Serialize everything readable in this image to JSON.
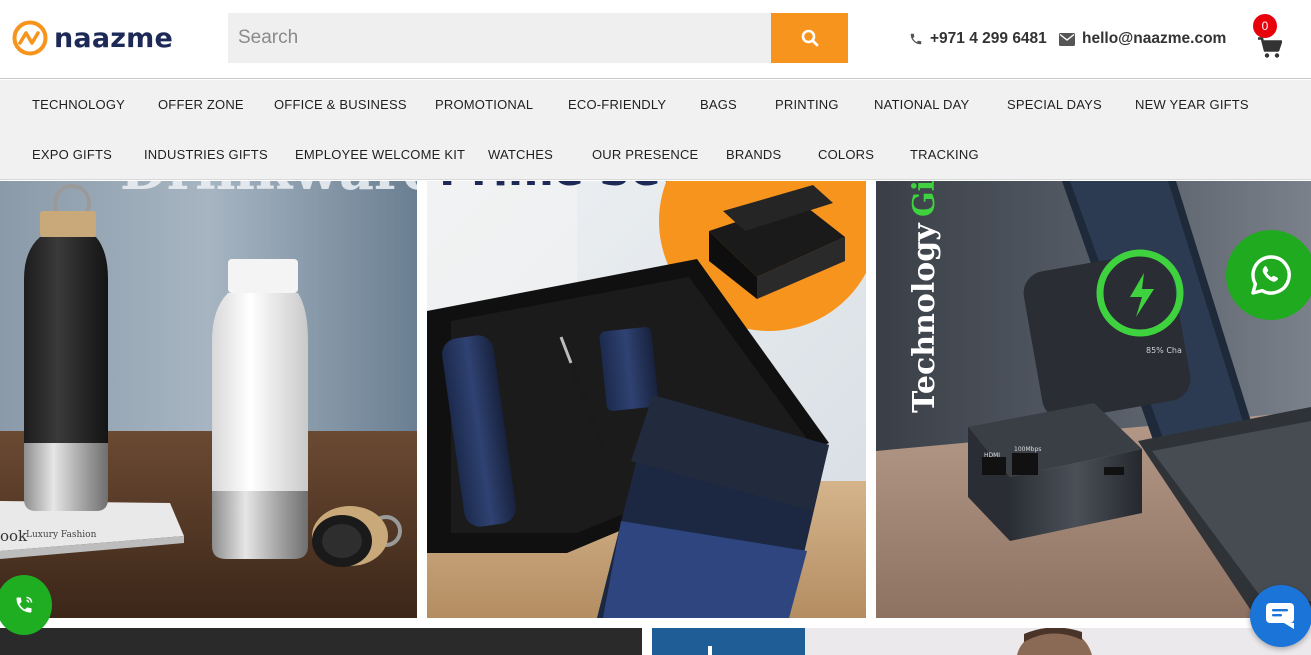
{
  "brand": {
    "name": "naazme",
    "logo_color": "#f7941d",
    "text_color": "#1d2a57"
  },
  "search": {
    "placeholder": "Search",
    "value": "",
    "button_icon": "search-icon",
    "button_color": "#f7941d"
  },
  "contact": {
    "phone": "+971 4 299 6481",
    "phone_icon": "phone-icon",
    "email": "hello@naazme.com",
    "email_icon": "envelope-icon"
  },
  "cart": {
    "count": "0",
    "icon": "shopping-cart-icon",
    "badge_color": "#e8000b"
  },
  "nav": {
    "row1": [
      "TECHNOLOGY",
      "OFFER ZONE",
      "OFFICE & BUSINESS",
      "PROMOTIONAL",
      "ECO-FRIENDLY",
      "BAGS",
      "PRINTING",
      "NATIONAL DAY",
      "SPECIAL DAYS",
      "NEW YEAR GIFTS"
    ],
    "row2": [
      "EXPO GIFTS",
      "INDUSTRIES GIFTS",
      "EMPLOYEE WELCOME KIT",
      "WATCHES",
      "OUR PRESENCE",
      "BRANDS",
      "COLORS",
      "TRACKING"
    ]
  },
  "banners": {
    "drinkware": {
      "heading": "Drinkware",
      "book_text": "ook",
      "book_subtext": "Luxury Fashion"
    },
    "gift_set": {
      "heading": "Prime Set"
    },
    "technology": {
      "heading_main": "Technology",
      "heading_accent": "Gi",
      "accent_color": "#3fd23f",
      "screen_text": "85% Cha",
      "port_label_1": "HDMI",
      "port_label_2": "100Mbps"
    }
  },
  "floating": {
    "phone_icon": "phone-call-icon",
    "whatsapp_icon": "whatsapp-icon",
    "chat_icon": "chat-bubble-icon",
    "green": "#1fae22",
    "blue": "#1b74d8"
  }
}
